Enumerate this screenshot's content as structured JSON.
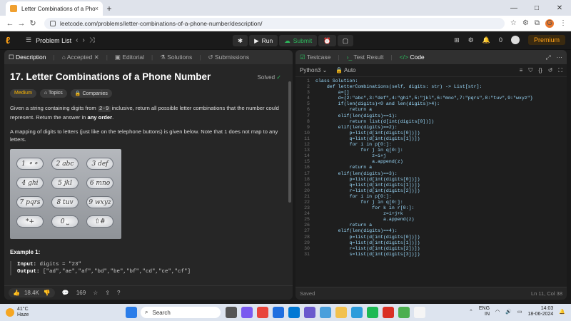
{
  "browser": {
    "tab_title": "Letter Combinations of a Phone",
    "tab_close": "×",
    "new_tab": "+",
    "url": "leetcode.com/problems/letter-combinations-of-a-phone-number/description/",
    "win_min": "—",
    "win_max": "□",
    "win_close": "✕",
    "profile_initial": "G"
  },
  "lc": {
    "problem_list": "Problem List",
    "run": "Run",
    "submit": "Submit",
    "streak": "0",
    "premium": "Premium"
  },
  "left_tabs": {
    "description": "Description",
    "accepted": "Accepted",
    "editorial": "Editorial",
    "solutions": "Solutions",
    "submissions": "Submissions"
  },
  "problem": {
    "title": "17. Letter Combinations of a Phone Number",
    "status": "Solved",
    "difficulty": "Medium",
    "topics": "Topics",
    "companies": "Companies",
    "desc_p1_a": "Given a string containing digits from ",
    "desc_p1_code": "2-9",
    "desc_p1_b": " inclusive, return all possible letter combinations that the number could represent. Return the answer in ",
    "desc_p1_bold": "any order",
    "desc_p1_end": ".",
    "desc_p2": "A mapping of digits to letters (just like on the telephone buttons) is given below. Note that 1 does not map to any letters.",
    "keypad": [
      "1 ⚬⚬",
      "2 abc",
      "3 def",
      "4 ghi",
      "5 jkl",
      "6 mno",
      "7 pqrs",
      "8 tuv",
      "9 wxyz",
      "*+",
      "0 ⎵",
      "⇧#"
    ],
    "example_title": "Example 1:",
    "input_label": "Input:",
    "input_value": " digits = \"23\"",
    "output_label": "Output:",
    "output_value": " [\"ad\",\"ae\",\"af\",\"bd\",\"be\",\"bf\",\"cd\",\"ce\",\"cf\"]",
    "likes": "18.4K",
    "comments": "169"
  },
  "right_tabs": {
    "testcase": "Testcase",
    "test_result": "Test Result",
    "code": "Code"
  },
  "editor": {
    "language": "Python3",
    "auto": "Auto",
    "saved": "Saved",
    "position": "Ln 11, Col 38",
    "lines": [
      "class Solution:",
      "    def letterCombinations(self, digits: str) -> List[str]:",
      "        a=[]",
      "        d={2:\"abc\",3:\"def\",4:\"ghi\",5:\"jkl\",6:\"mno\",7:\"pqrs\",8:\"tuv\",9:\"wxyz\"}",
      "        if(len(digits)<0 and len(digits)>4):",
      "            return a",
      "        elif(len(digits)==1):",
      "            return list(d[int(digits[0])])",
      "        elif(len(digits)==2):",
      "            p=list(d[int(digits[0])])",
      "            q=list(d[int(digits[1])])",
      "            for i in p[0:]:",
      "                for j in q[0:]:",
      "                    z=i+j",
      "                    a.append(z)",
      "            return a",
      "        elif(len(digits)==3):",
      "            p=list(d[int(digits[0])])",
      "            q=list(d[int(digits[1])])",
      "            r=list(d[int(digits[2])])",
      "            for i in p[0:]:",
      "                for j in q[0:]:",
      "                    for k in r[0:]:",
      "                        z=i+j+k",
      "                        a.append(z)",
      "            return a",
      "        elif(len(digits)==4):",
      "            p=list(d[int(digits[0])])",
      "            q=list(d[int(digits[1])])",
      "            r=list(d[int(digits[2])])",
      "            s=list(d[int(digits[3])])"
    ]
  },
  "taskbar": {
    "temp": "41°C",
    "weather": "Haze",
    "search": "Search",
    "lang": "ENG",
    "region": "IN",
    "time": "14:03",
    "date": "18-06-2024"
  }
}
